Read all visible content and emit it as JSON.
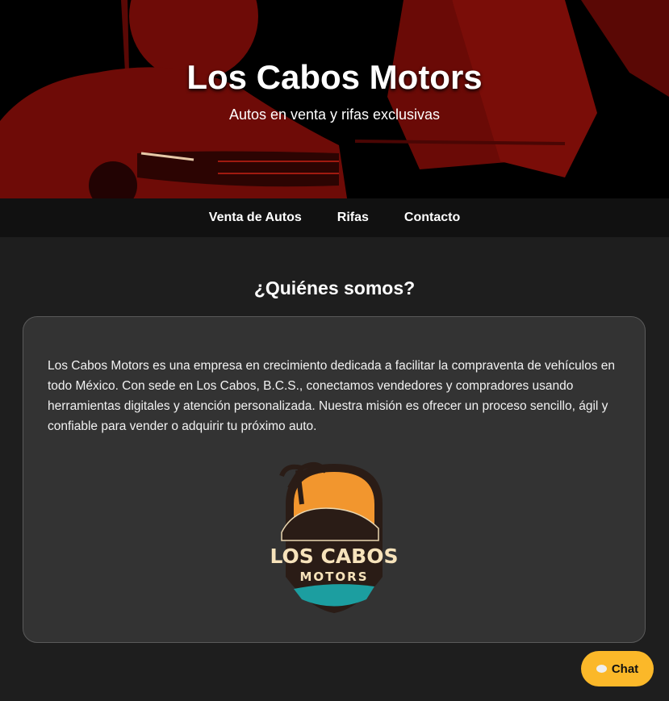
{
  "header": {
    "title": "Los Cabos Motors",
    "subtitle": "Autos en venta y rifas exclusivas"
  },
  "nav": {
    "items": [
      {
        "label": "Venta de Autos"
      },
      {
        "label": "Rifas"
      },
      {
        "label": "Contacto"
      }
    ]
  },
  "about": {
    "heading": "¿Quiénes somos?",
    "text": "Los Cabos Motors es una empresa en crecimiento dedicada a facilitar la compraventa de vehículos en todo México. Con sede en Los Cabos, B.C.S., conectamos vendedores y compradores usando herramientas digitales y atención personalizada. Nuestra misión es ofrecer un proceso sencillo, ágil y confiable para vender o adquirir tu próximo auto.",
    "logo": {
      "line1": "LOS CABOS",
      "line2": "MOTORS"
    }
  },
  "chat": {
    "label": "Chat",
    "icon": "speech-bubble-icon"
  },
  "colors": {
    "accent": "#fbb829",
    "hero_red": "#7a0d08",
    "card": "#333333"
  }
}
